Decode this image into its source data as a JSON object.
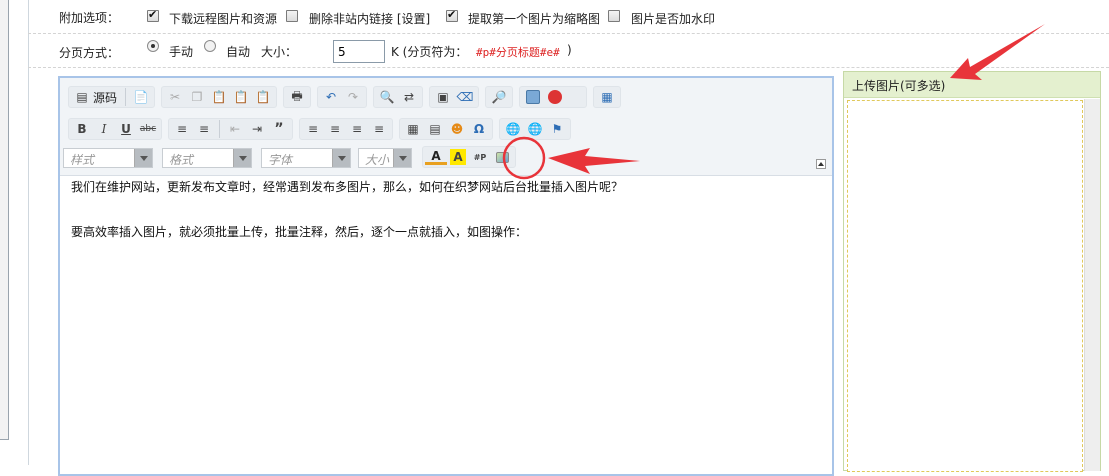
{
  "options": {
    "label": "附加选项：",
    "items": [
      {
        "label": "下载远程图片和资源",
        "checked": true
      },
      {
        "label": "删除非站内链接 [设置]",
        "checked": false
      },
      {
        "label": "提取第一个图片为缩略图",
        "checked": true
      },
      {
        "label": "图片是否加水印",
        "checked": false
      }
    ]
  },
  "pagination": {
    "label": "分页方式：",
    "manual_label": "手动",
    "auto_label": "自动",
    "selected": "手动",
    "size_label": "大小：",
    "size_value": "5",
    "separator_label": "K (分页符为：",
    "separator_code": "#p#分页标题#e#",
    "separator_close": ")"
  },
  "editor": {
    "source_label": "源码",
    "combos": {
      "style": "样式",
      "format": "格式",
      "font": "字体",
      "size": "大小"
    },
    "content": [
      "我们在维护网站，更新发布文章时，经常遇到发布多图片，那么，如何在织梦网站后台批量插入图片呢？",
      "要高效率插入图片，就必须批量上传，批量注释，然后，逐个一点就插入，如图操作："
    ]
  },
  "upload": {
    "title": "上传图片(可多选)"
  },
  "colors": {
    "accent_red": "#e8343a",
    "editor_border": "#a8c4e8",
    "upload_header": "#e4f0cf"
  }
}
